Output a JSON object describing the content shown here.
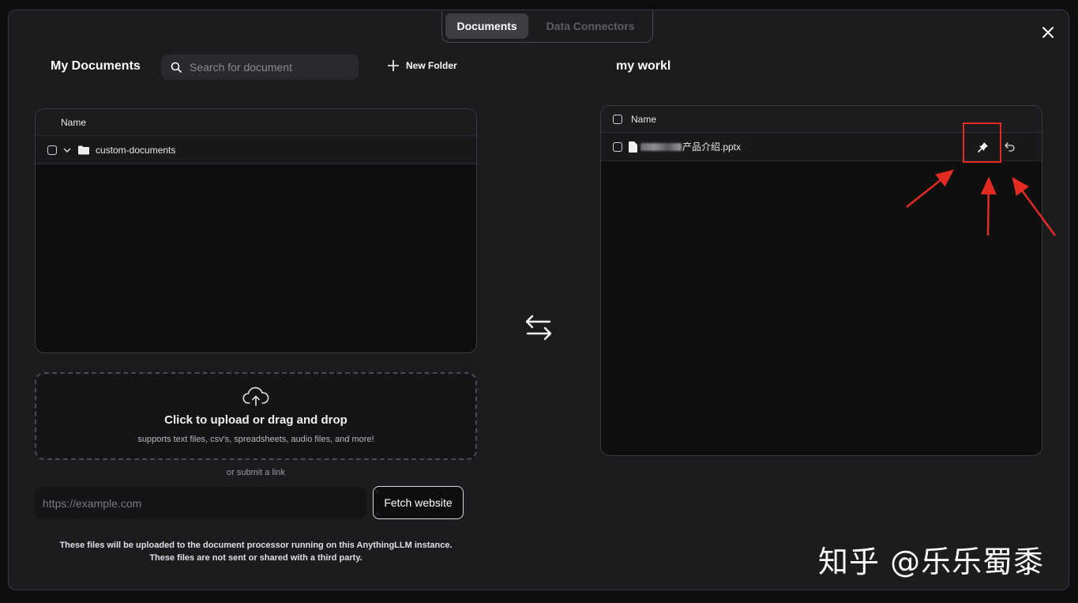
{
  "tabs": [
    {
      "label": "Documents",
      "active": true
    },
    {
      "label": "Data Connectors",
      "active": false
    }
  ],
  "left": {
    "title": "My Documents",
    "search_placeholder": "Search for document",
    "new_folder_label": "New Folder",
    "header_name": "Name",
    "rows": [
      {
        "name": "custom-documents",
        "type": "folder",
        "expanded": false
      }
    ]
  },
  "upload": {
    "title": "Click to upload or drag and drop",
    "subtitle": "supports text files, csv's, spreadsheets, audio files, and more!",
    "or_link": "or submit a link",
    "url_placeholder": "https://example.com",
    "fetch_label": "Fetch website"
  },
  "disclaimer": {
    "line1": "These files will be uploaded to the document processor running on this AnythingLLM instance.",
    "line2": "These files are not sent or shared with a third party."
  },
  "right": {
    "title": "my workl",
    "header_name": "Name",
    "rows": [
      {
        "name_suffix": "产品介绍.pptx",
        "type": "file"
      }
    ]
  },
  "watermark": "知乎 @乐乐蜀黍",
  "colors": {
    "accent_red": "#e32b22",
    "background": "#1c1c1f",
    "panel": "#0e0f0f"
  },
  "icons": [
    "close-icon",
    "search-icon",
    "plus-icon",
    "chevron-down-icon",
    "folder-icon",
    "file-icon",
    "pin-icon",
    "undo-icon",
    "upload-cloud-icon",
    "swap-arrows-icon"
  ]
}
